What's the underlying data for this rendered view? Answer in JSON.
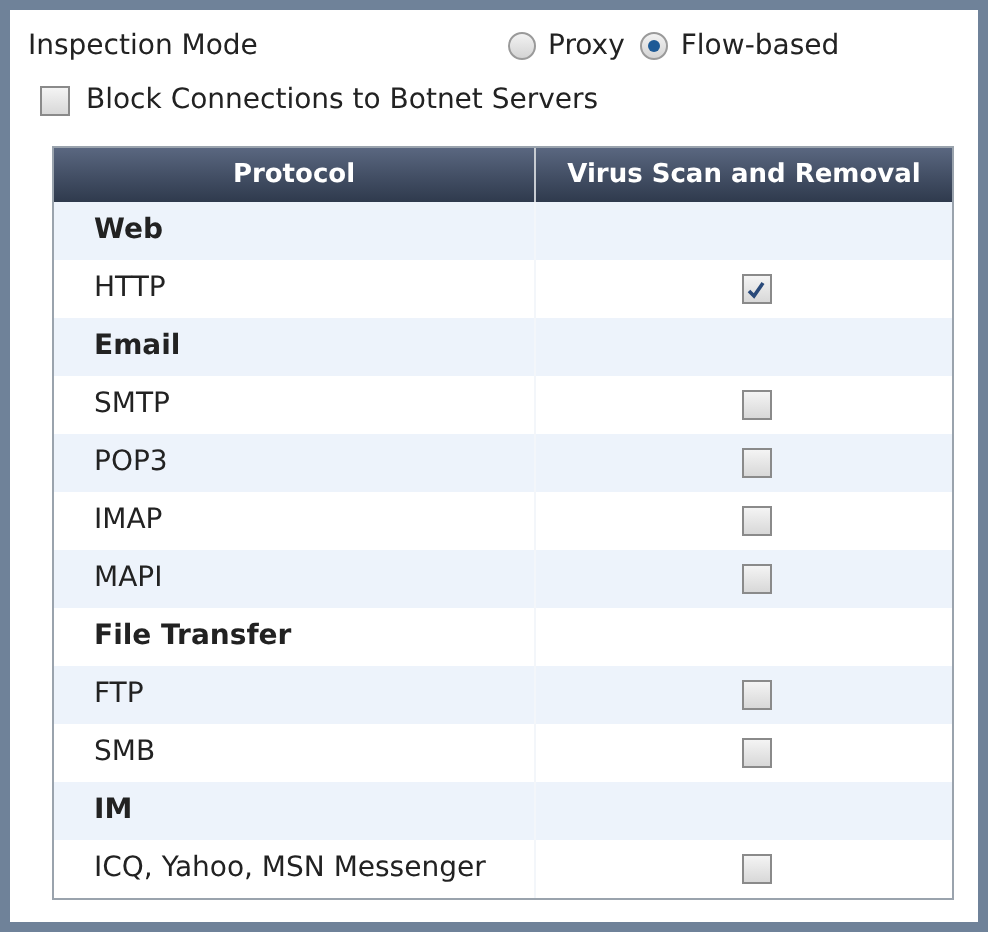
{
  "inspection_mode": {
    "label": "Inspection Mode",
    "options": [
      {
        "label": "Proxy",
        "selected": false
      },
      {
        "label": "Flow-based",
        "selected": true
      }
    ]
  },
  "block_botnet": {
    "label": "Block Connections to Botnet Servers",
    "checked": false
  },
  "table": {
    "columns": [
      "Protocol",
      "Virus Scan and Removal"
    ],
    "rows": [
      {
        "kind": "group",
        "label": "Web"
      },
      {
        "kind": "protocol",
        "label": "HTTP",
        "checked": true
      },
      {
        "kind": "group",
        "label": "Email"
      },
      {
        "kind": "protocol",
        "label": "SMTP",
        "checked": false
      },
      {
        "kind": "protocol",
        "label": "POP3",
        "checked": false
      },
      {
        "kind": "protocol",
        "label": "IMAP",
        "checked": false
      },
      {
        "kind": "protocol",
        "label": "MAPI",
        "checked": false
      },
      {
        "kind": "group",
        "label": "File Transfer"
      },
      {
        "kind": "protocol",
        "label": "FTP",
        "checked": false
      },
      {
        "kind": "protocol",
        "label": "SMB",
        "checked": false
      },
      {
        "kind": "group",
        "label": "IM"
      },
      {
        "kind": "protocol",
        "label": "ICQ, Yahoo, MSN Messenger",
        "checked": false
      }
    ]
  }
}
